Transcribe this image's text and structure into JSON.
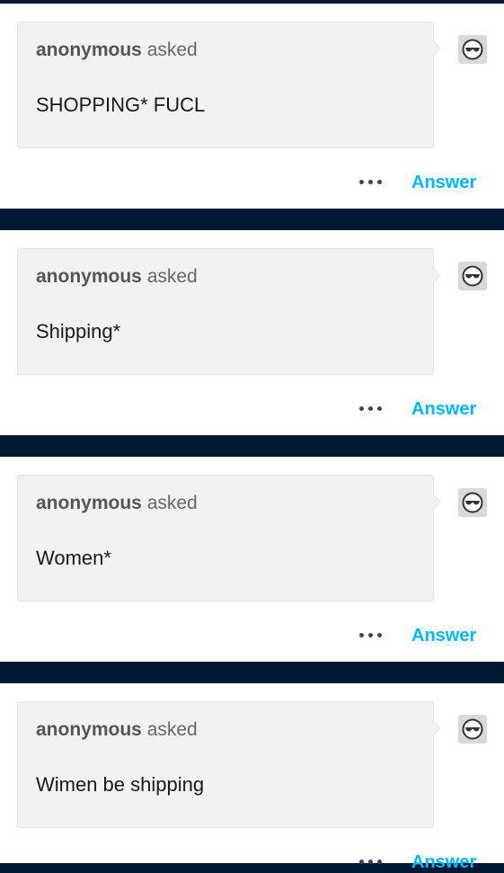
{
  "colors": {
    "background": "#001935",
    "card": "#ffffff",
    "bubble": "#f2f2f2",
    "accent": "#00b8ff"
  },
  "asks": [
    {
      "asker": "anonymous",
      "verb": "asked",
      "question": "SHOPPING* FUCL",
      "answer_label": "Answer",
      "more_icon": "more-dots-icon",
      "avatar_icon": "sunglasses-avatar-icon"
    },
    {
      "asker": "anonymous",
      "verb": "asked",
      "question": "Shipping*",
      "answer_label": "Answer",
      "more_icon": "more-dots-icon",
      "avatar_icon": "sunglasses-avatar-icon"
    },
    {
      "asker": "anonymous",
      "verb": "asked",
      "question": "Women*",
      "answer_label": "Answer",
      "more_icon": "more-dots-icon",
      "avatar_icon": "sunglasses-avatar-icon"
    },
    {
      "asker": "anonymous",
      "verb": "asked",
      "question": "Wimen be shipping",
      "answer_label": "Answer",
      "more_icon": "more-dots-icon",
      "avatar_icon": "sunglasses-avatar-icon"
    }
  ]
}
